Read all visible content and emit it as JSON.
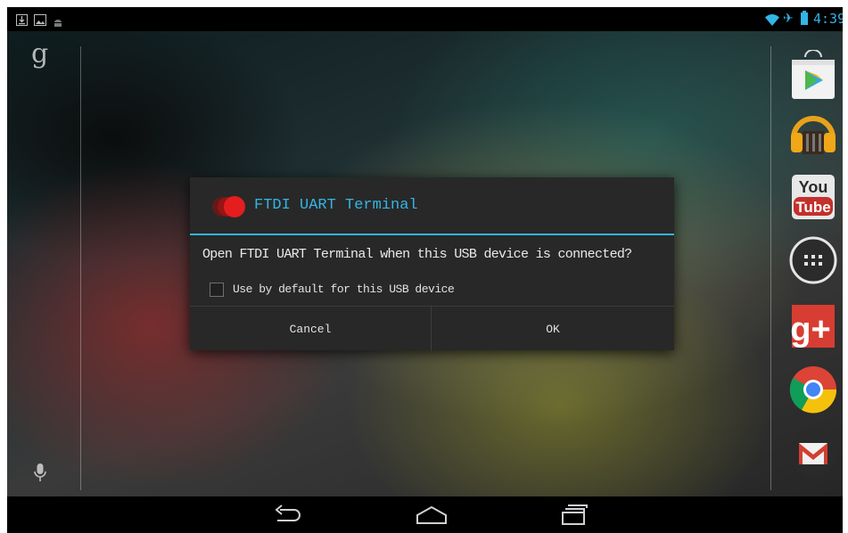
{
  "status_bar": {
    "left_icons": [
      "download-icon",
      "image-notification-icon",
      "android-debug-icon"
    ],
    "right_icons": [
      "wifi-icon",
      "airplane-mode-icon",
      "battery-icon"
    ],
    "time": "4:39"
  },
  "home": {
    "search_label": "g",
    "voice_icon": "microphone-icon",
    "dock_apps": [
      {
        "name": "Play Store",
        "icon": "play-store-icon"
      },
      {
        "name": "Play Music",
        "icon": "headphones-icon"
      },
      {
        "name": "YouTube",
        "icon": "youtube-icon",
        "text_top": "You",
        "text_bottom": "Tube"
      },
      {
        "name": "All Apps",
        "icon": "all-apps-icon"
      },
      {
        "name": "Google+",
        "icon": "google-plus-icon",
        "text": "g+"
      },
      {
        "name": "Chrome",
        "icon": "chrome-icon"
      },
      {
        "name": "Gmail",
        "icon": "gmail-icon"
      }
    ]
  },
  "dialog": {
    "title": "FTDI UART Terminal",
    "app_icon": "ftdi-app-icon",
    "message": "Open FTDI UART Terminal when this USB device is connected?",
    "checkbox_label": "Use by default for this USB device",
    "checkbox_checked": false,
    "cancel_label": "Cancel",
    "ok_label": "OK",
    "accent_color": "#33b5e5"
  },
  "nav_bar": {
    "buttons": [
      "back-icon",
      "home-icon",
      "recent-apps-icon"
    ]
  }
}
